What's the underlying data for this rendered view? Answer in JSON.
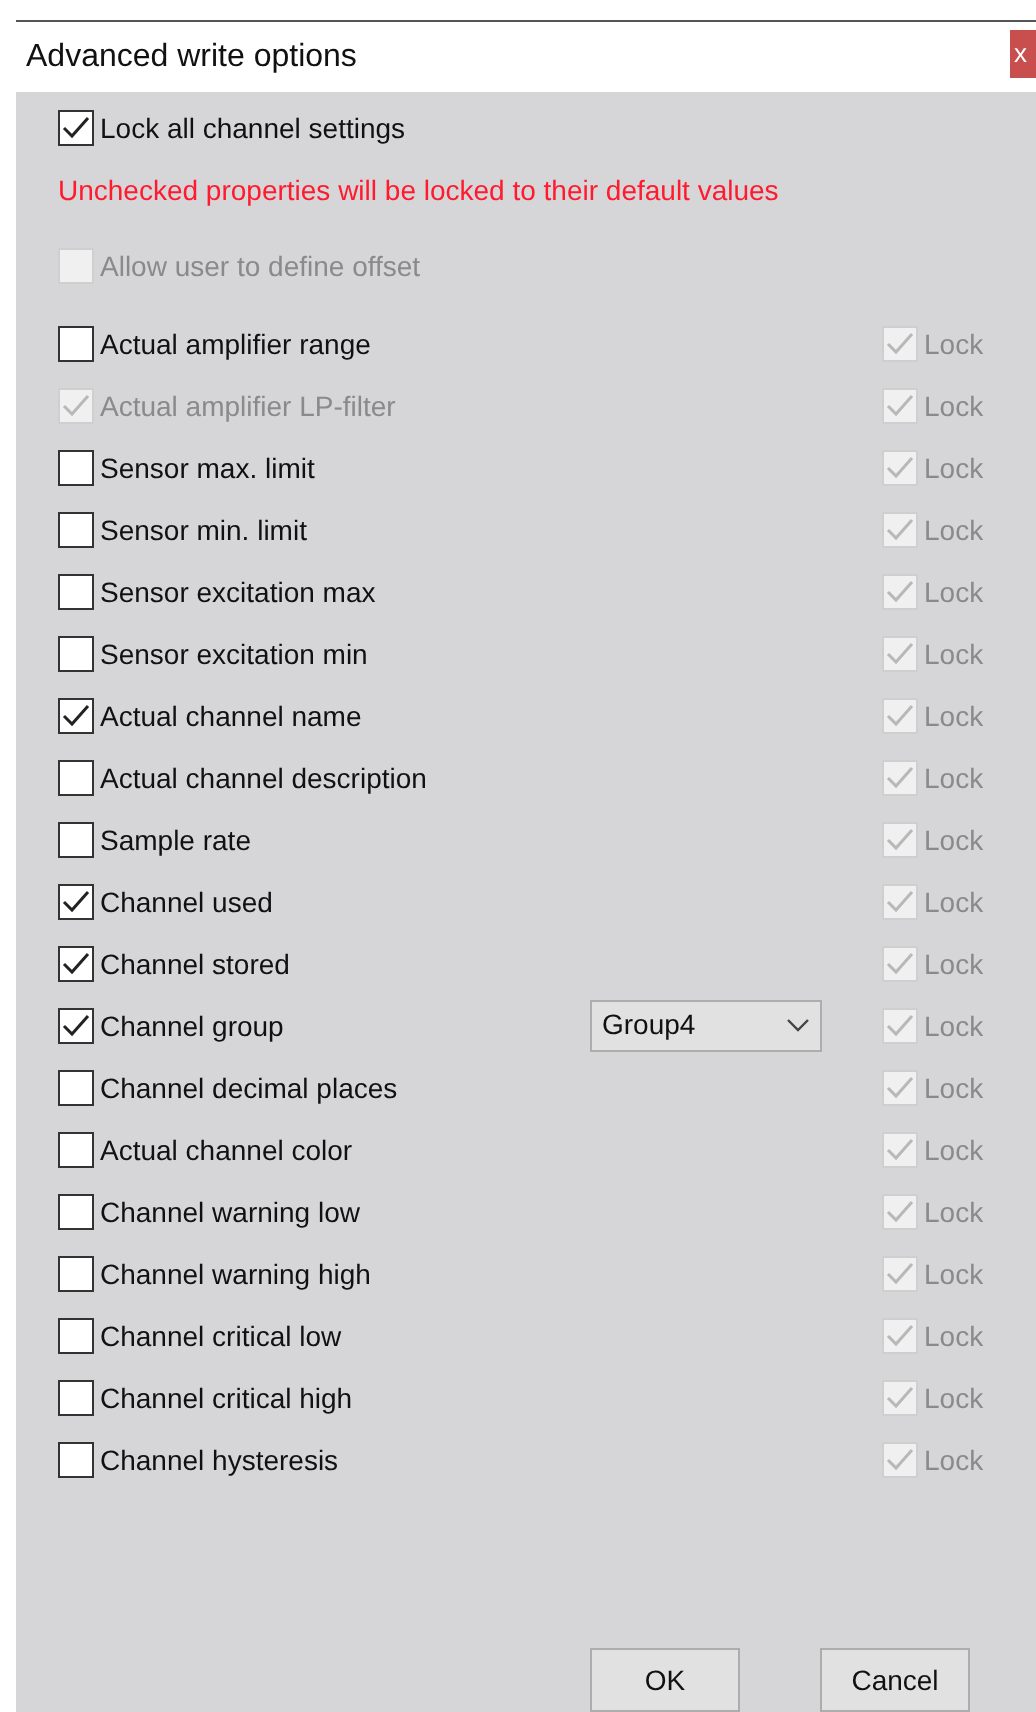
{
  "window": {
    "title": "Advanced write options",
    "close": "x"
  },
  "lock_all": {
    "label": "Lock all channel settings",
    "checked": true
  },
  "warning": "Unchecked properties will be locked to their default values",
  "allow_offset": {
    "label": "Allow user to define offset",
    "checked": false,
    "disabled": true
  },
  "properties": [
    {
      "label": "Actual amplifier range",
      "checked": false,
      "disabled": false,
      "lock": {
        "label": "Lock",
        "checked": true,
        "disabled": true
      }
    },
    {
      "label": "Actual amplifier LP-filter",
      "checked": true,
      "disabled": true,
      "lock": {
        "label": "Lock",
        "checked": true,
        "disabled": true
      }
    },
    {
      "label": "Sensor max. limit",
      "checked": false,
      "disabled": false,
      "lock": {
        "label": "Lock",
        "checked": true,
        "disabled": true
      }
    },
    {
      "label": "Sensor min. limit",
      "checked": false,
      "disabled": false,
      "lock": {
        "label": "Lock",
        "checked": true,
        "disabled": true
      }
    },
    {
      "label": "Sensor excitation max",
      "checked": false,
      "disabled": false,
      "lock": {
        "label": "Lock",
        "checked": true,
        "disabled": true
      }
    },
    {
      "label": "Sensor excitation min",
      "checked": false,
      "disabled": false,
      "lock": {
        "label": "Lock",
        "checked": true,
        "disabled": true
      }
    },
    {
      "label": "Actual channel name",
      "checked": true,
      "disabled": false,
      "lock": {
        "label": "Lock",
        "checked": true,
        "disabled": true
      }
    },
    {
      "label": "Actual channel description",
      "checked": false,
      "disabled": false,
      "lock": {
        "label": "Lock",
        "checked": true,
        "disabled": true
      }
    },
    {
      "label": "Sample rate",
      "checked": false,
      "disabled": false,
      "lock": {
        "label": "Lock",
        "checked": true,
        "disabled": true
      }
    },
    {
      "label": "Channel used",
      "checked": true,
      "disabled": false,
      "lock": {
        "label": "Lock",
        "checked": true,
        "disabled": true
      }
    },
    {
      "label": "Channel stored",
      "checked": true,
      "disabled": false,
      "lock": {
        "label": "Lock",
        "checked": true,
        "disabled": true
      }
    },
    {
      "label": "Channel group",
      "checked": true,
      "disabled": false,
      "dropdown": {
        "value": "Group4"
      },
      "lock": {
        "label": "Lock",
        "checked": true,
        "disabled": true
      }
    },
    {
      "label": "Channel decimal places",
      "checked": false,
      "disabled": false,
      "lock": {
        "label": "Lock",
        "checked": true,
        "disabled": true
      }
    },
    {
      "label": "Actual channel color",
      "checked": false,
      "disabled": false,
      "lock": {
        "label": "Lock",
        "checked": true,
        "disabled": true
      }
    },
    {
      "label": "Channel warning low",
      "checked": false,
      "disabled": false,
      "lock": {
        "label": "Lock",
        "checked": true,
        "disabled": true
      }
    },
    {
      "label": "Channel warning high",
      "checked": false,
      "disabled": false,
      "lock": {
        "label": "Lock",
        "checked": true,
        "disabled": true
      }
    },
    {
      "label": "Channel critical low",
      "checked": false,
      "disabled": false,
      "lock": {
        "label": "Lock",
        "checked": true,
        "disabled": true
      }
    },
    {
      "label": "Channel critical high",
      "checked": false,
      "disabled": false,
      "lock": {
        "label": "Lock",
        "checked": true,
        "disabled": true
      }
    },
    {
      "label": "Channel hysteresis",
      "checked": false,
      "disabled": false,
      "lock": {
        "label": "Lock",
        "checked": true,
        "disabled": true
      }
    }
  ],
  "buttons": [
    "OK",
    "Cancel"
  ]
}
